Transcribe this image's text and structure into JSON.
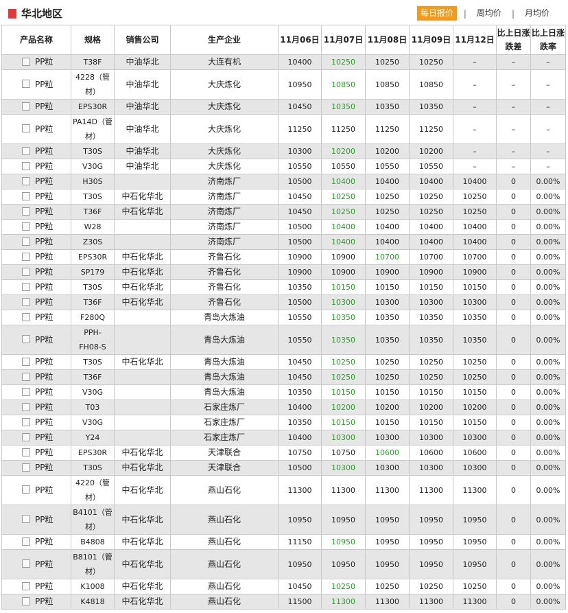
{
  "header": {
    "title": "华北地区",
    "tabs": [
      "每日报价",
      "周均价",
      "月均价"
    ],
    "active_tab": 0,
    "accent_color": "#f39a1c",
    "title_mark_color": "#e03a3a"
  },
  "table": {
    "columns": [
      "产品名称",
      "规格",
      "销售公司",
      "生产企业",
      "11月06日",
      "11月07日",
      "11月08日",
      "11月09日",
      "11月12日",
      "比上日涨跌差",
      "比上日涨跌率"
    ],
    "rows": [
      {
        "product": "PP粒",
        "spec": "T38F",
        "company": "中油华北",
        "mfr": "大连有机",
        "p": [
          "10400",
          "10250",
          "10250",
          "10250",
          "–"
        ],
        "diff": "–",
        "rate": "–",
        "hl": 1
      },
      {
        "product": "PP粒",
        "spec": "4228（管材）",
        "company": "中油华北",
        "mfr": "大庆炼化",
        "p": [
          "10950",
          "10850",
          "10850",
          "10850",
          "–"
        ],
        "diff": "–",
        "rate": "–",
        "hl": 1
      },
      {
        "product": "PP粒",
        "spec": "EPS30R",
        "company": "中油华北",
        "mfr": "大庆炼化",
        "p": [
          "10450",
          "10350",
          "10350",
          "10350",
          "–"
        ],
        "diff": "–",
        "rate": "–",
        "hl": 1
      },
      {
        "product": "PP粒",
        "spec": "PA14D（管材）",
        "company": "中油华北",
        "mfr": "大庆炼化",
        "p": [
          "11250",
          "11250",
          "11250",
          "11250",
          "–"
        ],
        "diff": "–",
        "rate": "–",
        "hl": -1
      },
      {
        "product": "PP粒",
        "spec": "T30S",
        "company": "中油华北",
        "mfr": "大庆炼化",
        "p": [
          "10300",
          "10200",
          "10200",
          "10200",
          "–"
        ],
        "diff": "–",
        "rate": "–",
        "hl": 1
      },
      {
        "product": "PP粒",
        "spec": "V30G",
        "company": "中油华北",
        "mfr": "大庆炼化",
        "p": [
          "10550",
          "10550",
          "10550",
          "10550",
          "–"
        ],
        "diff": "–",
        "rate": "–",
        "hl": -1
      },
      {
        "product": "PP粒",
        "spec": "H30S",
        "company": "",
        "mfr": "济南炼厂",
        "p": [
          "10500",
          "10400",
          "10400",
          "10400",
          "10400"
        ],
        "diff": "0",
        "rate": "0.00%",
        "hl": 1
      },
      {
        "product": "PP粒",
        "spec": "T30S",
        "company": "中石化华北",
        "mfr": "济南炼厂",
        "p": [
          "10450",
          "10250",
          "10250",
          "10250",
          "10250"
        ],
        "diff": "0",
        "rate": "0.00%",
        "hl": 1
      },
      {
        "product": "PP粒",
        "spec": "T36F",
        "company": "中石化华北",
        "mfr": "济南炼厂",
        "p": [
          "10450",
          "10250",
          "10250",
          "10250",
          "10250"
        ],
        "diff": "0",
        "rate": "0.00%",
        "hl": 1
      },
      {
        "product": "PP粒",
        "spec": "W28",
        "company": "",
        "mfr": "济南炼厂",
        "p": [
          "10500",
          "10400",
          "10400",
          "10400",
          "10400"
        ],
        "diff": "0",
        "rate": "0.00%",
        "hl": 1
      },
      {
        "product": "PP粒",
        "spec": "Z30S",
        "company": "",
        "mfr": "济南炼厂",
        "p": [
          "10500",
          "10400",
          "10400",
          "10400",
          "10400"
        ],
        "diff": "0",
        "rate": "0.00%",
        "hl": 1
      },
      {
        "product": "PP粒",
        "spec": "EPS30R",
        "company": "中石化华北",
        "mfr": "齐鲁石化",
        "p": [
          "10900",
          "10900",
          "10700",
          "10700",
          "10700"
        ],
        "diff": "0",
        "rate": "0.00%",
        "hl": 2
      },
      {
        "product": "PP粒",
        "spec": "SP179",
        "company": "中石化华北",
        "mfr": "齐鲁石化",
        "p": [
          "10900",
          "10900",
          "10900",
          "10900",
          "10900"
        ],
        "diff": "0",
        "rate": "0.00%",
        "hl": -1
      },
      {
        "product": "PP粒",
        "spec": "T30S",
        "company": "中石化华北",
        "mfr": "齐鲁石化",
        "p": [
          "10350",
          "10150",
          "10150",
          "10150",
          "10150"
        ],
        "diff": "0",
        "rate": "0.00%",
        "hl": 1
      },
      {
        "product": "PP粒",
        "spec": "T36F",
        "company": "中石化华北",
        "mfr": "齐鲁石化",
        "p": [
          "10500",
          "10300",
          "10300",
          "10300",
          "10300"
        ],
        "diff": "0",
        "rate": "0.00%",
        "hl": 1
      },
      {
        "product": "PP粒",
        "spec": "F280Q",
        "company": "",
        "mfr": "青岛大炼油",
        "p": [
          "10550",
          "10350",
          "10350",
          "10350",
          "10350"
        ],
        "diff": "0",
        "rate": "0.00%",
        "hl": 1
      },
      {
        "product": "PP粒",
        "spec": "PPH-FH08-S",
        "company": "",
        "mfr": "青岛大炼油",
        "p": [
          "10550",
          "10350",
          "10350",
          "10350",
          "10350"
        ],
        "diff": "0",
        "rate": "0.00%",
        "hl": 1
      },
      {
        "product": "PP粒",
        "spec": "T30S",
        "company": "中石化华北",
        "mfr": "青岛大炼油",
        "p": [
          "10450",
          "10250",
          "10250",
          "10250",
          "10250"
        ],
        "diff": "0",
        "rate": "0.00%",
        "hl": 1
      },
      {
        "product": "PP粒",
        "spec": "T36F",
        "company": "",
        "mfr": "青岛大炼油",
        "p": [
          "10450",
          "10250",
          "10250",
          "10250",
          "10250"
        ],
        "diff": "0",
        "rate": "0.00%",
        "hl": 1
      },
      {
        "product": "PP粒",
        "spec": "V30G",
        "company": "",
        "mfr": "青岛大炼油",
        "p": [
          "10350",
          "10150",
          "10150",
          "10150",
          "10150"
        ],
        "diff": "0",
        "rate": "0.00%",
        "hl": 1
      },
      {
        "product": "PP粒",
        "spec": "T03",
        "company": "",
        "mfr": "石家庄炼厂",
        "p": [
          "10400",
          "10200",
          "10200",
          "10200",
          "10200"
        ],
        "diff": "0",
        "rate": "0.00%",
        "hl": 1
      },
      {
        "product": "PP粒",
        "spec": "V30G",
        "company": "",
        "mfr": "石家庄炼厂",
        "p": [
          "10350",
          "10150",
          "10150",
          "10150",
          "10150"
        ],
        "diff": "0",
        "rate": "0.00%",
        "hl": 1
      },
      {
        "product": "PP粒",
        "spec": "Y24",
        "company": "",
        "mfr": "石家庄炼厂",
        "p": [
          "10400",
          "10300",
          "10300",
          "10300",
          "10300"
        ],
        "diff": "0",
        "rate": "0.00%",
        "hl": 1
      },
      {
        "product": "PP粒",
        "spec": "EPS30R",
        "company": "中石化华北",
        "mfr": "天津联合",
        "p": [
          "10750",
          "10750",
          "10600",
          "10600",
          "10600"
        ],
        "diff": "0",
        "rate": "0.00%",
        "hl": 2
      },
      {
        "product": "PP粒",
        "spec": "T30S",
        "company": "中石化华北",
        "mfr": "天津联合",
        "p": [
          "10500",
          "10300",
          "10300",
          "10300",
          "10300"
        ],
        "diff": "0",
        "rate": "0.00%",
        "hl": 1
      },
      {
        "product": "PP粒",
        "spec": "4220（管材）",
        "company": "中石化华北",
        "mfr": "燕山石化",
        "p": [
          "11300",
          "11300",
          "11300",
          "11300",
          "11300"
        ],
        "diff": "0",
        "rate": "0.00%",
        "hl": -1
      },
      {
        "product": "PP粒",
        "spec": "B4101（管材）",
        "company": "中石化华北",
        "mfr": "燕山石化",
        "p": [
          "10950",
          "10950",
          "10950",
          "10950",
          "10950"
        ],
        "diff": "0",
        "rate": "0.00%",
        "hl": -1
      },
      {
        "product": "PP粒",
        "spec": "B4808",
        "company": "中石化华北",
        "mfr": "燕山石化",
        "p": [
          "11150",
          "10950",
          "10950",
          "10950",
          "10950"
        ],
        "diff": "0",
        "rate": "0.00%",
        "hl": 1
      },
      {
        "product": "PP粒",
        "spec": "B8101（管材）",
        "company": "中石化华北",
        "mfr": "燕山石化",
        "p": [
          "10950",
          "10950",
          "10950",
          "10950",
          "10950"
        ],
        "diff": "0",
        "rate": "0.00%",
        "hl": -1
      },
      {
        "product": "PP粒",
        "spec": "K1008",
        "company": "中石化华北",
        "mfr": "燕山石化",
        "p": [
          "10450",
          "10250",
          "10250",
          "10250",
          "10250"
        ],
        "diff": "0",
        "rate": "0.00%",
        "hl": 1
      },
      {
        "product": "PP粒",
        "spec": "K4818",
        "company": "中石化华北",
        "mfr": "燕山石化",
        "p": [
          "11500",
          "11300",
          "11300",
          "11300",
          "11300"
        ],
        "diff": "0",
        "rate": "0.00%",
        "hl": 1
      }
    ],
    "up_color": "#2b9a2b"
  }
}
